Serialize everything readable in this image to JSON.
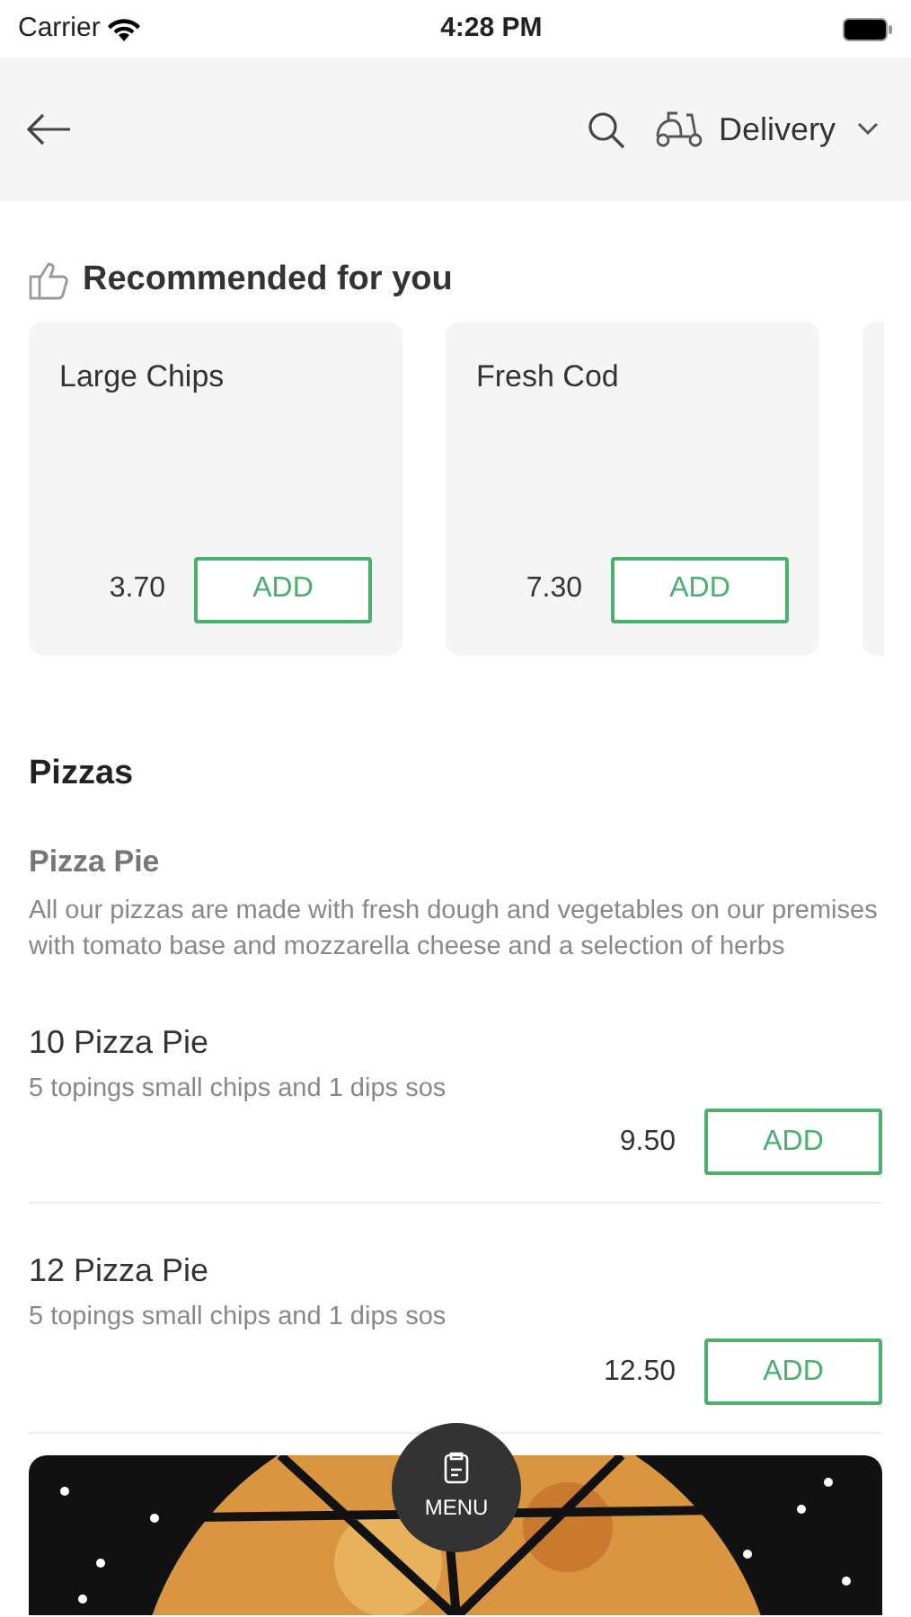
{
  "status_bar": {
    "carrier": "Carrier",
    "time": "4:28 PM"
  },
  "header": {
    "delivery_mode": "Delivery"
  },
  "recommended": {
    "title": "Recommended for you",
    "items": [
      {
        "name": "Large Chips",
        "price": "3.70",
        "button": "ADD"
      },
      {
        "name": "Fresh Cod",
        "price": "7.30",
        "button": "ADD"
      }
    ]
  },
  "category": {
    "title": "Pizzas",
    "name": "Pizza Pie",
    "description": "All our pizzas are made with fresh dough and vegetables on our premises with tomato base and mozzarella cheese and a selection of herbs"
  },
  "items": [
    {
      "name": "10 Pizza Pie",
      "subtitle": "5 topings small chips and 1 dips sos",
      "price": "9.50",
      "button": "ADD"
    },
    {
      "name": "12 Pizza Pie",
      "subtitle": "5 topings small chips and 1 dips sos",
      "price": "12.50",
      "button": "ADD"
    }
  ],
  "menu_button": {
    "label": "MENU"
  }
}
